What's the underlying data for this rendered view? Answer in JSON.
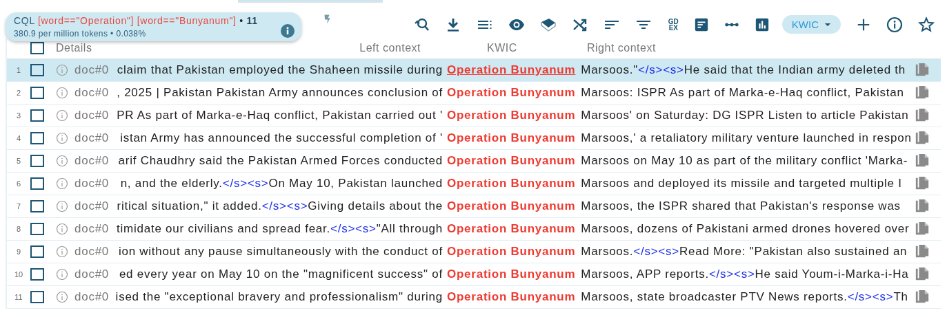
{
  "query_box": {
    "label": "CQL",
    "query": "[word==\"Operation\"] [word==\"Bunyanum\"]",
    "separator": "•",
    "count": "11",
    "stats": "380.9 per million tokens • 0.038%"
  },
  "toolbar": {
    "gdex_label": "GD EX",
    "view_mode": "KWIC"
  },
  "header": {
    "all_checked": false,
    "details": "Details",
    "left": "Left context",
    "kwic": "KWIC",
    "right": "Right context"
  },
  "rows": [
    {
      "number": "1",
      "selected": true,
      "checked": false,
      "doc": "doc#0",
      "left": [
        {
          "kind": "text",
          "text": "claim that Pakistan employed the Shaheen missile during"
        }
      ],
      "kwic": "Operation Bunyanum",
      "right": [
        {
          "kind": "text",
          "text": "Marsoos.\""
        },
        {
          "kind": "tag",
          "text": "</s><s>"
        },
        {
          "kind": "text",
          "text": "He said that the Indian army deleted th"
        }
      ]
    },
    {
      "number": "2",
      "selected": false,
      "checked": false,
      "doc": "doc#0",
      "left": [
        {
          "kind": "text",
          "text": ", 2025 | Pakistan Pakistan Army announces conclusion of"
        }
      ],
      "kwic": "Operation Bunyanum",
      "right": [
        {
          "kind": "text",
          "text": "Marsoos: ISPR As part of Marka-e-Haq conflict, Pakistan"
        }
      ]
    },
    {
      "number": "3",
      "selected": false,
      "checked": false,
      "doc": "doc#0",
      "left": [
        {
          "kind": "text",
          "text": "PR As part of Marka-e-Haq conflict, Pakistan carried out '"
        }
      ],
      "kwic": "Operation Bunyanum",
      "right": [
        {
          "kind": "text",
          "text": "Marsoos' on Saturday: DG ISPR Listen to article Pakistan"
        }
      ]
    },
    {
      "number": "4",
      "selected": false,
      "checked": false,
      "doc": "doc#0",
      "left": [
        {
          "kind": "text",
          "text": "istan Army has announced the successful completion of '"
        }
      ],
      "kwic": "Operation Bunyanum",
      "right": [
        {
          "kind": "text",
          "text": "Marsoos,' a retaliatory military venture launched in respon"
        }
      ]
    },
    {
      "number": "5",
      "selected": false,
      "checked": false,
      "doc": "doc#0",
      "left": [
        {
          "kind": "text",
          "text": "arif Chaudhry said the Pakistan Armed Forces conducted"
        }
      ],
      "kwic": "Operation Bunyanum",
      "right": [
        {
          "kind": "text",
          "text": "Marsoos on May 10 as part of the military conflict 'Marka-"
        }
      ]
    },
    {
      "number": "6",
      "selected": false,
      "checked": false,
      "doc": "doc#0",
      "left": [
        {
          "kind": "text",
          "text": "n, and the elderly."
        },
        {
          "kind": "tag",
          "text": "</s><s>"
        },
        {
          "kind": "text",
          "text": "On May 10, Pakistan launched"
        }
      ],
      "kwic": "Operation Bunyanum",
      "right": [
        {
          "kind": "text",
          "text": "Marsoos and deployed its missile and targeted multiple I"
        }
      ]
    },
    {
      "number": "7",
      "selected": false,
      "checked": false,
      "doc": "doc#0",
      "left": [
        {
          "kind": "text",
          "text": "ritical situation,\" it added."
        },
        {
          "kind": "tag",
          "text": "</s><s>"
        },
        {
          "kind": "text",
          "text": "Giving details about the"
        }
      ],
      "kwic": "Operation Bunyanum",
      "right": [
        {
          "kind": "text",
          "text": "Marsoos, the ISPR shared that Pakistan's response was"
        }
      ]
    },
    {
      "number": "8",
      "selected": false,
      "checked": false,
      "doc": "doc#0",
      "left": [
        {
          "kind": "text",
          "text": "timidate our civilians and spread fear."
        },
        {
          "kind": "tag",
          "text": "</s><s>"
        },
        {
          "kind": "text",
          "text": "\"All through"
        }
      ],
      "kwic": "Operation Bunyanum",
      "right": [
        {
          "kind": "text",
          "text": "Marsoos, dozens of Pakistani armed drones hovered over"
        }
      ]
    },
    {
      "number": "9",
      "selected": false,
      "checked": false,
      "doc": "doc#0",
      "left": [
        {
          "kind": "text",
          "text": "ion without any pause simultaneously with the conduct of"
        }
      ],
      "kwic": "Operation Bunyanum",
      "right": [
        {
          "kind": "text",
          "text": "Marsoos."
        },
        {
          "kind": "tag",
          "text": "</s><s>"
        },
        {
          "kind": "text",
          "text": "Read More: \"Pakistan also sustained an"
        }
      ]
    },
    {
      "number": "10",
      "selected": false,
      "checked": false,
      "doc": "doc#0",
      "left": [
        {
          "kind": "text",
          "text": "ed every year on May 10 on the \"magnificent success\" of"
        }
      ],
      "kwic": "Operation Bunyanum",
      "right": [
        {
          "kind": "text",
          "text": "Marsoos, APP reports."
        },
        {
          "kind": "tag",
          "text": "</s><s>"
        },
        {
          "kind": "text",
          "text": "He said Youm-i-Marka-i-Ha"
        }
      ]
    },
    {
      "number": "11",
      "selected": false,
      "checked": false,
      "doc": "doc#0",
      "left": [
        {
          "kind": "text",
          "text": "ised the \"exceptional bravery and professionalism\" during"
        }
      ],
      "kwic": "Operation Bunyanum",
      "right": [
        {
          "kind": "text",
          "text": "Marsoos, state broadcaster PTV News reports."
        },
        {
          "kind": "tag",
          "text": "</s><s>"
        },
        {
          "kind": "text",
          "text": "Th"
        }
      ]
    }
  ]
}
